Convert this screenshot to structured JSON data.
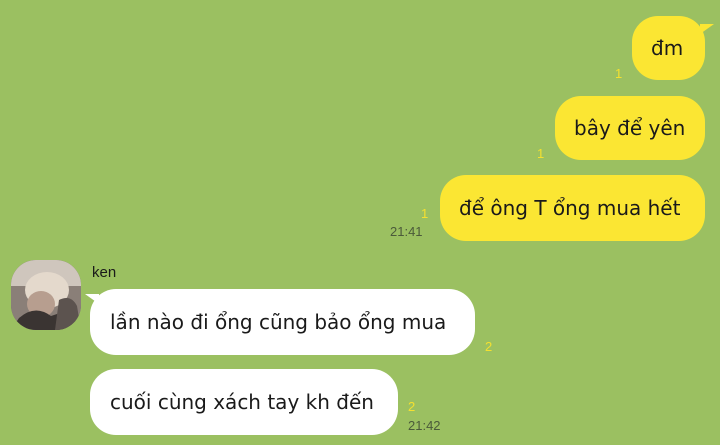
{
  "conversation": {
    "outgoing": [
      {
        "text": "đm",
        "unread": "1"
      },
      {
        "text": "bây để yên",
        "unread": "1"
      },
      {
        "text": "để ông T ổng mua hết",
        "unread": "1",
        "time": "21:41"
      }
    ],
    "incoming": {
      "sender": "ken",
      "avatar_icon": "user-photo-avatar",
      "messages": [
        {
          "text": "lần nào đi ổng cũng bảo ổng mua",
          "unread": "2"
        },
        {
          "text": "cuối cùng xách tay kh đến",
          "unread": "2",
          "time": "21:42"
        }
      ]
    }
  },
  "colors": {
    "background": "#9bc061",
    "outgoing_bubble": "#fbe633",
    "incoming_bubble": "#ffffff",
    "unread_count": "#f4e030"
  }
}
